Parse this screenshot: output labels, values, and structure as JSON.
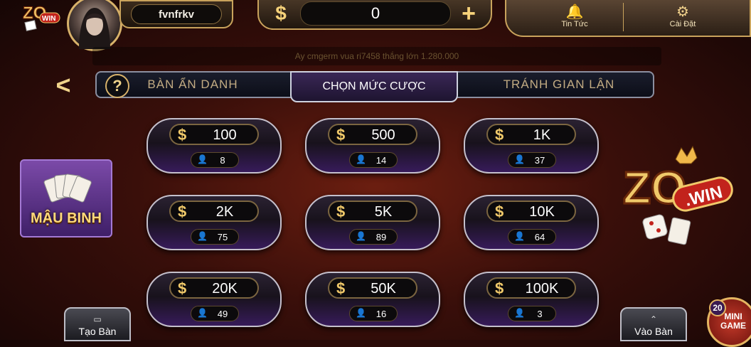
{
  "header": {
    "brand_logo": "ZO WIN",
    "username": "fvnfrkv",
    "balance": "0",
    "currency_icon": "$",
    "add_icon": "+",
    "news_label": "Tin Tức",
    "settings_label": "Cài Đặt"
  },
  "marquee": {
    "text": "Ay cmgerm vua ri7458 thắng lớn 1.280.000"
  },
  "tabs": {
    "back_icon": "<",
    "help_icon": "?",
    "items": [
      {
        "label": "BÀN ẨN DANH"
      },
      {
        "label": "CHỌN MỨC CƯỢC"
      },
      {
        "label": "TRÁNH GIAN LẬN"
      }
    ],
    "active_index": 1
  },
  "bets": [
    {
      "amount": "100",
      "players": "8"
    },
    {
      "amount": "500",
      "players": "14"
    },
    {
      "amount": "1K",
      "players": "37"
    },
    {
      "amount": "2K",
      "players": "75"
    },
    {
      "amount": "5K",
      "players": "89"
    },
    {
      "amount": "10K",
      "players": "64"
    },
    {
      "amount": "20K",
      "players": "49"
    },
    {
      "amount": "50K",
      "players": "16"
    },
    {
      "amount": "100K",
      "players": "3"
    }
  ],
  "side": {
    "game_name": "MẬU BINH",
    "brand_big": "ZO WIN"
  },
  "bottom": {
    "create_table": "Tạo Bàn",
    "join_table": "Vào Bàn",
    "mini_game_label": "MINI GAME",
    "mini_game_count": "20"
  },
  "colors": {
    "gold": "#d8b26a",
    "purple": "#371b5a",
    "bg": "#3a0f0a"
  }
}
